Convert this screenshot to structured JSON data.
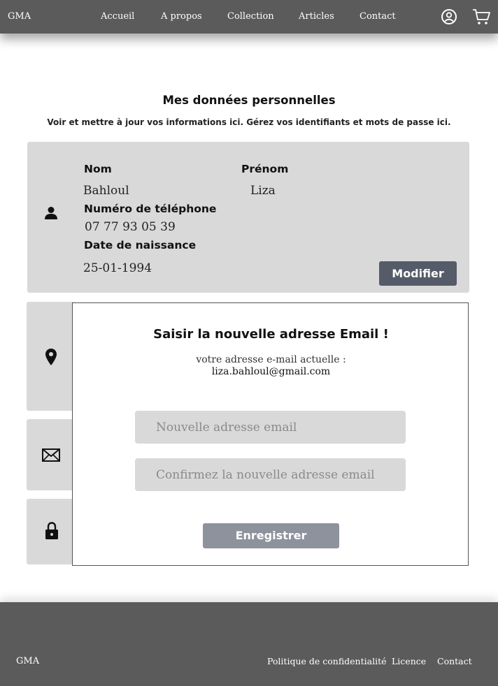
{
  "header": {
    "brand": "GMA",
    "nav": [
      "Accueil",
      "A propos",
      "Collection",
      "Articles",
      "Contact"
    ],
    "icons": [
      "user-circle-icon",
      "cart-icon"
    ]
  },
  "page": {
    "title": "Mes données personnelles",
    "subtitle": "Voir et mettre à jour vos informations ici. Gérez vos identifiants et mots de passe ici."
  },
  "personal": {
    "nom_label": "Nom",
    "nom_value": "Bahloul",
    "prenom_label": "Prénom",
    "prenom_value": "Liza",
    "phone_label": "Numéro de téléphone",
    "phone_value": "07 77 93 05 39",
    "birth_label": "Date de naissance",
    "birth_value": "25-01-1994",
    "modify_label": "Modifier"
  },
  "side_icons": [
    "person-icon",
    "location-pin-icon",
    "envelope-icon",
    "lock-icon"
  ],
  "modal": {
    "title": "Saisir la nouvelle adresse Email !",
    "current_label": "votre adresse e-mail actuelle :",
    "current_email": "liza.bahloul@gmail.com",
    "new_email_placeholder": "Nouvelle adresse email",
    "confirm_email_placeholder": "Confirmez la nouvelle adresse email",
    "save_label": "Enregistrer"
  },
  "footer": {
    "brand": "GMA",
    "links": [
      "Politique de confidentialité",
      "Licence",
      "Contact"
    ]
  },
  "colors": {
    "header_bg": "#5b5b5b",
    "card_bg": "#d9d9d9",
    "modify_button": "#555b68",
    "save_button": "#8e929d"
  }
}
